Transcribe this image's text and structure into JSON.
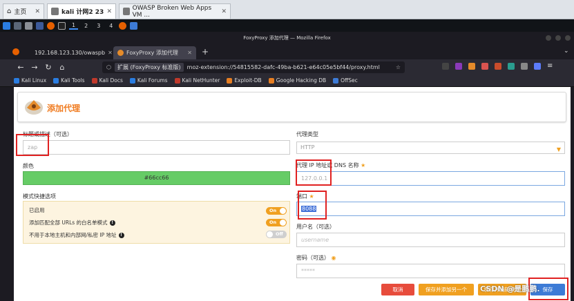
{
  "vm_tabs": [
    {
      "label": "主页",
      "icon": "home-icon"
    },
    {
      "label": "kali 计网2 23",
      "icon": "vm-icon"
    },
    {
      "label": "OWASP Broken Web Apps VM ...",
      "icon": "vm-icon"
    }
  ],
  "kali_panel": {
    "workspaces": [
      "1",
      "2",
      "3",
      "4"
    ]
  },
  "firefox": {
    "title": "FoxyProxy 添加代理 — Mozilla Firefox",
    "tabs": [
      {
        "label": "192.168.123.130/owaspb"
      },
      {
        "label": "FoxyProxy 添加代理"
      }
    ],
    "url_badge": "扩展 (FoxyProxy 标准版)",
    "url": "moz-extension://54815582-dafc-49ba-b621-e64c05e5bf44/proxy.html",
    "bookmarks": [
      "Kali Linux",
      "Kali Tools",
      "Kali Docs",
      "Kali Forums",
      "Kali NetHunter",
      "Exploit-DB",
      "Google Hacking DB",
      "OffSec"
    ]
  },
  "page": {
    "header_title": "添加代理",
    "left": {
      "title_label": "标题或描述（可选）",
      "title_value": "zap",
      "color_label": "颜色",
      "color_value": "#66cc66",
      "mode_label": "模式快捷选项",
      "mode_rows": [
        {
          "label": "已启用",
          "toggle": "On",
          "state": "on"
        },
        {
          "label": "添加匹配全部 URLs 的白名单模式",
          "toggle": "On",
          "state": "on",
          "info": true
        },
        {
          "label": "不用于本地主机和内部网/私密 IP 地址",
          "toggle": "Off",
          "state": "off",
          "info": true
        }
      ]
    },
    "right": {
      "type_label": "代理类型",
      "type_value": "HTTP",
      "host_label": "代理 IP 地址或 DNS 名称",
      "host_value": "127.0.0.1",
      "port_label": "端口",
      "port_value": "8088",
      "username_label": "用户名（可选）",
      "username_placeholder": "username",
      "password_label": "密码（可选）",
      "password_placeholder": "*****"
    },
    "buttons": {
      "cancel": "取消",
      "save_add": "保存并添加另一个",
      "save_edit": "保存并编辑模式",
      "save": "保存"
    }
  },
  "watermark": "CSDN @是鹏鹏.",
  "colors": {
    "accent": "#f07c21",
    "toggle_on": "#f0a020",
    "cancel": "#e74c3c",
    "save": "#3d7bd6",
    "highlight_box": "#e02020"
  }
}
